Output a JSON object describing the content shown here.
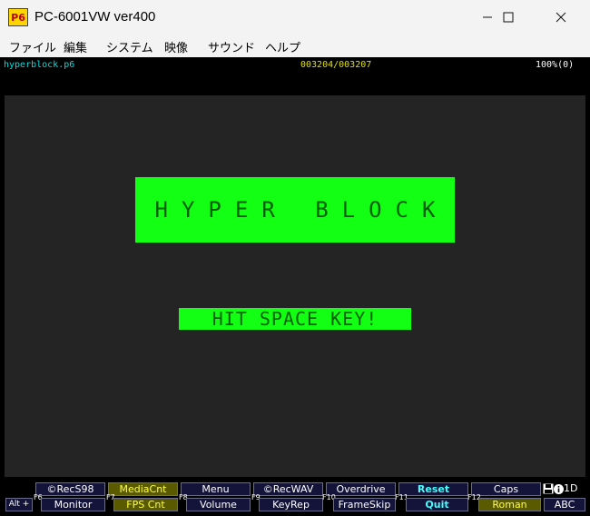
{
  "window": {
    "title": "PC-6001VW ver400",
    "icon_label": "P6",
    "icon_name": "p6-app-icon"
  },
  "menu": {
    "items": [
      "ファイル",
      "編集",
      "システム",
      "映像",
      "サウンド",
      "ヘルプ"
    ]
  },
  "status": {
    "filename": "hyperblock.p6",
    "counter": "003204/003207",
    "speed": "100%(0)"
  },
  "game": {
    "title": "HYPER BLOCK",
    "prompt": "HIT SPACE KEY!"
  },
  "fkeys": {
    "alt_label": "Alt +",
    "top_row": [
      {
        "label": "©RecS98"
      },
      {
        "label": "MediaCnt"
      },
      {
        "label": "Menu"
      },
      {
        "label": "©RecWAV"
      },
      {
        "label": "Overdrive"
      },
      {
        "label": "Reset"
      },
      {
        "label": "Caps"
      }
    ],
    "bottom_row": [
      {
        "key": "F6",
        "label": "Monitor"
      },
      {
        "key": "F7",
        "label": "FPS Cnt"
      },
      {
        "key": "F8",
        "label": "Volume"
      },
      {
        "key": "F9",
        "label": "KeyRep"
      },
      {
        "key": "F10",
        "label": "FrameSkip"
      },
      {
        "key": "F11",
        "label": "Quit"
      },
      {
        "key": "F12",
        "label": "Roman"
      }
    ],
    "extra_bottom": "ABC",
    "indicator": "1D"
  },
  "colors": {
    "screen_bg": "#242424",
    "block_green": "#13ff13",
    "block_text": "#006000",
    "highlight_yellow": "#5a5a00"
  }
}
